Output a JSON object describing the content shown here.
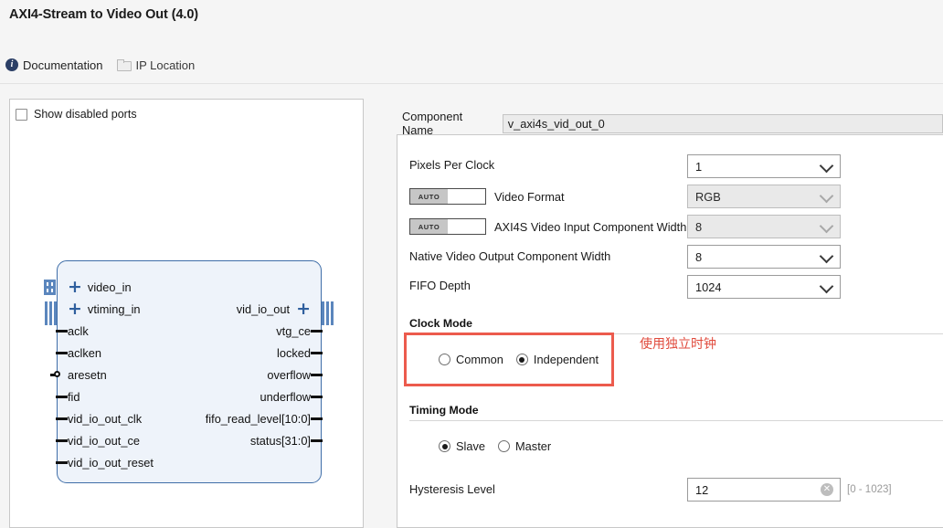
{
  "dialog": {
    "title": "AXI4-Stream to Video Out (4.0)"
  },
  "toolbar": {
    "documentation_label": "Documentation",
    "documentation_icon": "info-icon",
    "ip_location_label": "IP Location",
    "ip_location_icon": "folder-icon"
  },
  "left_panel": {
    "show_disabled_ports_label": "Show disabled ports",
    "show_disabled_ports_checked": false,
    "block": {
      "left_ports": [
        {
          "name": "video_in",
          "type": "bus"
        },
        {
          "name": "vtiming_in",
          "type": "bus"
        },
        {
          "name": "aclk",
          "type": "pin"
        },
        {
          "name": "aclken",
          "type": "pin"
        },
        {
          "name": "aresetn",
          "type": "pin-inverted"
        },
        {
          "name": "fid",
          "type": "pin"
        },
        {
          "name": "vid_io_out_clk",
          "type": "pin"
        },
        {
          "name": "vid_io_out_ce",
          "type": "pin"
        },
        {
          "name": "vid_io_out_reset",
          "type": "pin"
        }
      ],
      "right_ports": [
        {
          "name": "vid_io_out",
          "type": "bus"
        },
        {
          "name": "vtg_ce",
          "type": "pin"
        },
        {
          "name": "locked",
          "type": "pin"
        },
        {
          "name": "overflow",
          "type": "pin"
        },
        {
          "name": "underflow",
          "type": "pin"
        },
        {
          "name": "fifo_read_level[10:0]",
          "type": "pin"
        },
        {
          "name": "status[31:0]",
          "type": "pin"
        }
      ]
    }
  },
  "config": {
    "component_name_label": "Component Name",
    "component_name_value": "v_axi4s_vid_out_0",
    "fields": {
      "pixels_per_clock": {
        "label": "Pixels Per Clock",
        "value": "1",
        "disabled": false,
        "auto": false
      },
      "video_format": {
        "label": "Video Format",
        "value": "RGB",
        "disabled": true,
        "auto": true,
        "auto_label": "AUTO"
      },
      "axi4s_input_width": {
        "label": "AXI4S Video Input Component Width",
        "value": "8",
        "disabled": true,
        "auto": true,
        "auto_label": "AUTO"
      },
      "native_output_width": {
        "label": "Native Video Output Component Width",
        "value": "8",
        "disabled": false,
        "auto": false
      },
      "fifo_depth": {
        "label": "FIFO Depth",
        "value": "1024",
        "disabled": false,
        "auto": false
      }
    },
    "clock_mode": {
      "section_label": "Clock Mode",
      "options": [
        {
          "label": "Common",
          "selected": false
        },
        {
          "label": "Independent",
          "selected": true
        }
      ]
    },
    "timing_mode": {
      "section_label": "Timing Mode",
      "options": [
        {
          "label": "Slave",
          "selected": true
        },
        {
          "label": "Master",
          "selected": false
        }
      ]
    },
    "hysteresis": {
      "label": "Hysteresis Level",
      "value": "12",
      "range_hint": "[0 - 1023]",
      "clear_icon": "clear-icon"
    }
  },
  "annotation": {
    "note_text": "使用独立时钟",
    "note_color": "#e04a3c",
    "box_color": "#ec5b4d"
  }
}
